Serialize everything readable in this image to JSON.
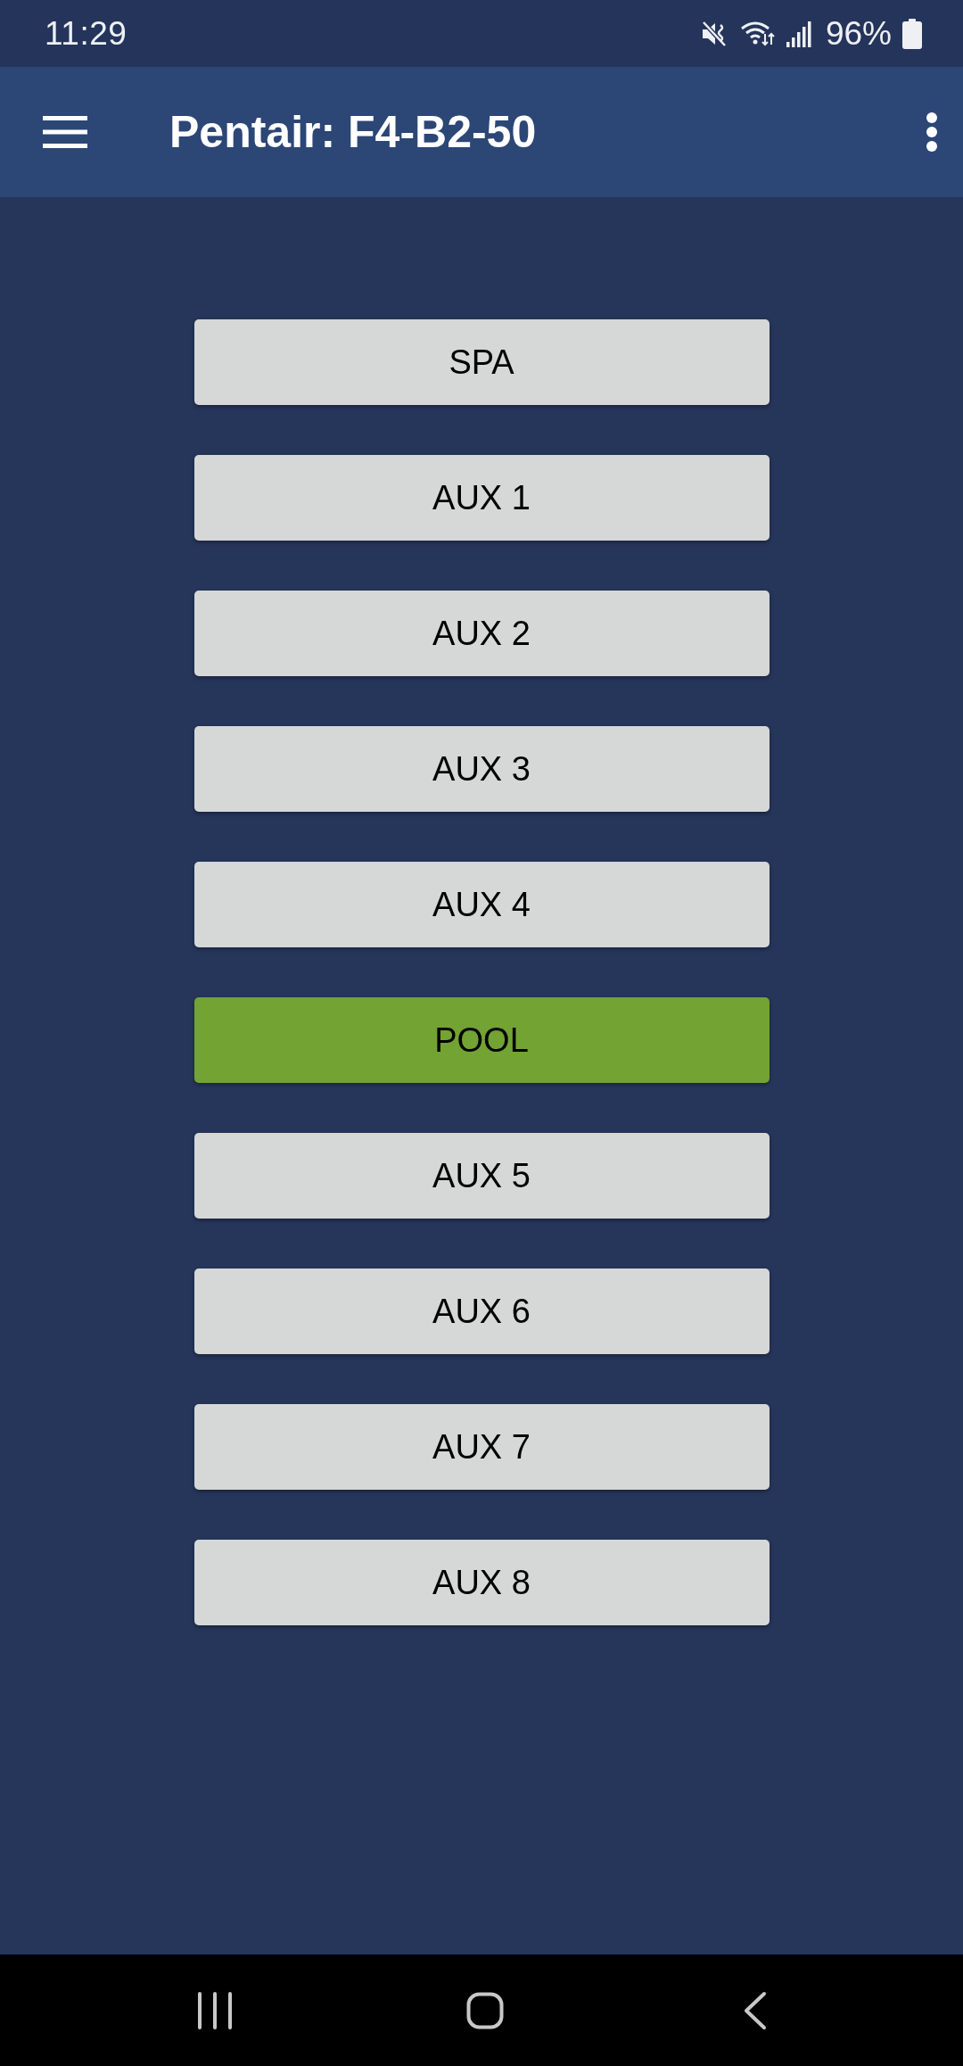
{
  "status_bar": {
    "time": "11:29",
    "battery": "96%"
  },
  "app_bar": {
    "title": "Pentair: F4-B2-50"
  },
  "buttons": [
    {
      "label": "SPA",
      "on": false
    },
    {
      "label": "AUX 1",
      "on": false
    },
    {
      "label": "AUX 2",
      "on": false
    },
    {
      "label": "AUX 3",
      "on": false
    },
    {
      "label": "AUX 4",
      "on": false
    },
    {
      "label": "POOL",
      "on": true
    },
    {
      "label": "AUX 5",
      "on": false
    },
    {
      "label": "AUX 6",
      "on": false
    },
    {
      "label": "AUX 7",
      "on": false
    },
    {
      "label": "AUX 8",
      "on": false
    }
  ]
}
